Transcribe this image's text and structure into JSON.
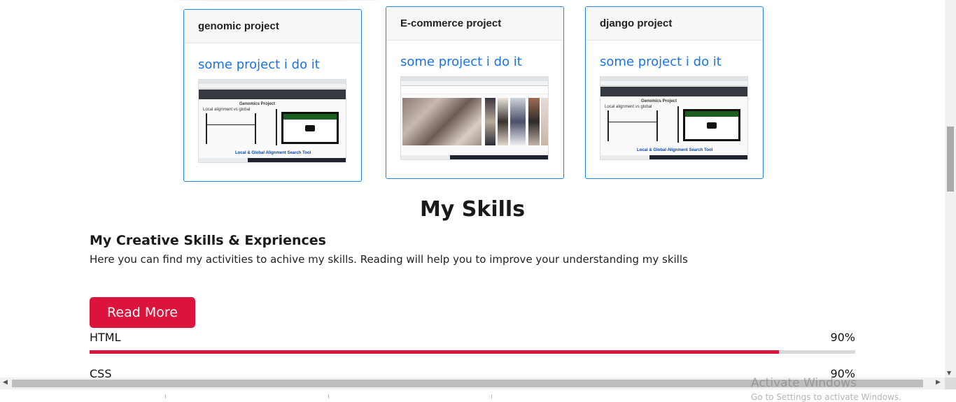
{
  "projects": [
    {
      "title": "genomic project",
      "link": "some project i do it",
      "thumb_caption": "Local alignment vs global",
      "thumb_heading": "Genomics Project",
      "thumb_footer": "Local & Global Alignment Search Tool"
    },
    {
      "title": "E-commerce project",
      "link": "some project i do it"
    },
    {
      "title": "django project",
      "link": "some project i do it",
      "thumb_caption": "Local alignment vs global",
      "thumb_heading": "Genomics Project",
      "thumb_footer": "Local & Global Alignment Search Tool"
    }
  ],
  "skills_section": {
    "heading": "My Skills",
    "subheading": "My Creative Skills & Expriences",
    "description": "Here you can find my activities to achive my skills. Reading will help you to improve your understanding my skills",
    "button_label": "Read More",
    "items": [
      {
        "name": "HTML",
        "percent_label": "90%",
        "level": 0.9
      },
      {
        "name": "CSS",
        "percent_label": "90%",
        "level": 0.9
      }
    ]
  },
  "os_overlay": {
    "activate_title": "Activate Windows",
    "activate_sub": "Go to Settings to activate Windows."
  },
  "colors": {
    "accent": "#dc143c",
    "link": "#1a73e8",
    "card_border": "#1e88e5"
  },
  "icons": {
    "scroll_up": "caret-up-icon",
    "scroll_down": "caret-down-icon",
    "scroll_left": "caret-left-icon",
    "scroll_right": "caret-right-icon",
    "play": "play-icon"
  }
}
